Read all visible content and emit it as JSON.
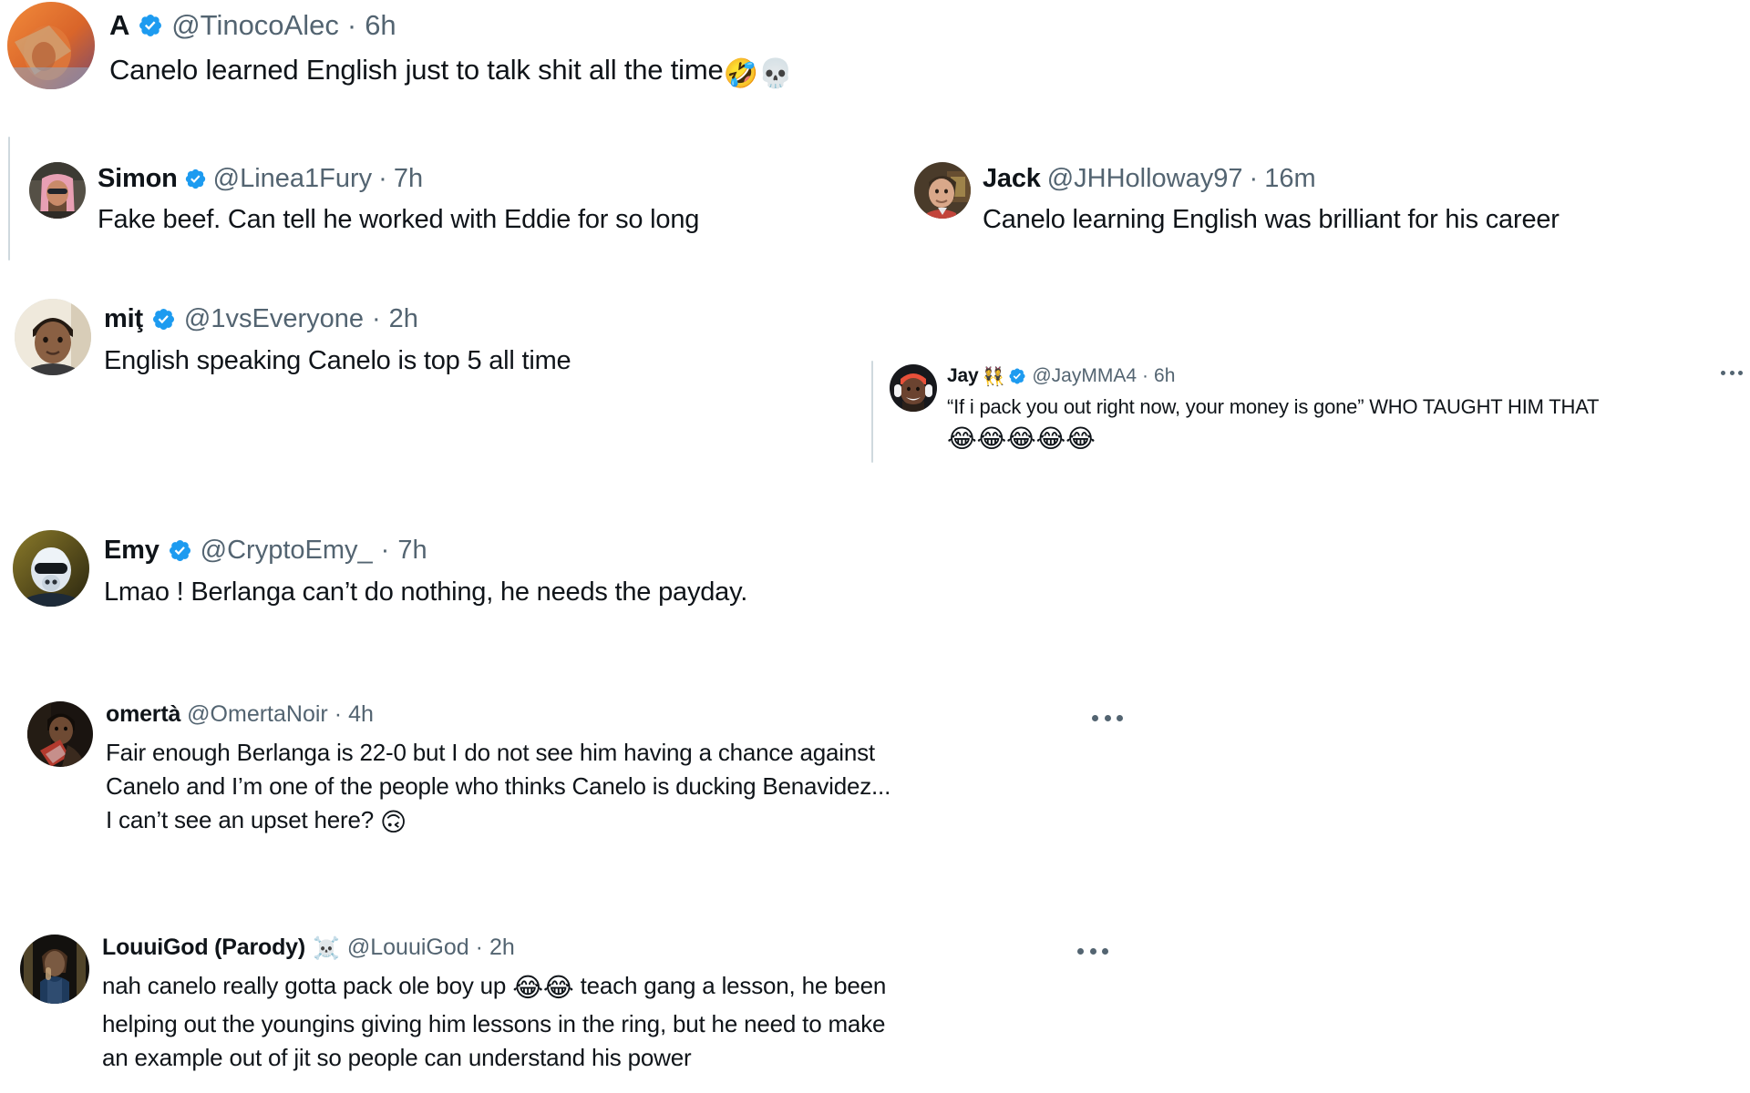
{
  "theme": {
    "background": "#ffffff",
    "text_primary": "#0f1419",
    "text_secondary": "#536471",
    "verified_blue": "#1d9bf0",
    "thread_line": "#cfd9de"
  },
  "tweets": [
    {
      "id": "tweet-tinocoalec",
      "display_name": "A",
      "verified": true,
      "handle": "@TinocoAlec",
      "separator": "·",
      "timestamp": "6h",
      "text": "Canelo learned English just to talk shit all the time",
      "trailing_emoji": "🤣💀",
      "has_more_menu": false
    },
    {
      "id": "tweet-linea1fury",
      "display_name": "Simon",
      "verified": true,
      "handle": "@Linea1Fury",
      "separator": "·",
      "timestamp": "7h",
      "text": "Fake beef. Can tell he worked with Eddie for so long",
      "has_more_menu": false
    },
    {
      "id": "tweet-jhholloway97",
      "display_name": "Jack",
      "verified": false,
      "handle": "@JHHolloway97",
      "separator": "·",
      "timestamp": "16m",
      "text": "Canelo learning English was brilliant for his career",
      "has_more_menu": false
    },
    {
      "id": "tweet-1vseveryone",
      "display_name": "miţ",
      "verified": true,
      "handle": "@1vsEveryone",
      "separator": "·",
      "timestamp": "2h",
      "text": "English speaking Canelo is top 5 all time",
      "has_more_menu": false
    },
    {
      "id": "tweet-jaymma4",
      "display_name": "Jay",
      "name_emoji": "👯",
      "verified": true,
      "handle": "@JayMMA4",
      "separator": "·",
      "timestamp": "6h",
      "text": "“If i pack you out right now, your money is gone” WHO TAUGHT HIM THAT",
      "trailing_emoji": "😂😂😂😂😂",
      "has_more_menu": true
    },
    {
      "id": "tweet-cryptoemy",
      "display_name": "Emy",
      "verified": true,
      "handle": "@CryptoEmy_",
      "separator": "·",
      "timestamp": "7h",
      "text": "Lmao ! Berlanga can’t do nothing, he needs the payday.",
      "has_more_menu": false
    },
    {
      "id": "tweet-omertanoir",
      "display_name": "omertà",
      "verified": false,
      "handle": "@OmertaNoir",
      "separator": "·",
      "timestamp": "4h",
      "line1": "Fair enough Berlanga is 22-0 but I do not see him having a chance against",
      "line2": "Canelo and I’m one of the people who thinks Canelo is ducking Benavidez...",
      "line3": "I can’t see an upset here? ",
      "line3_emoji": "🙃",
      "has_more_menu": true
    },
    {
      "id": "tweet-louuigod",
      "display_name": "LouuiGod (Parody)",
      "name_emoji": "☠️",
      "verified": false,
      "handle": "@LouuiGod",
      "separator": "·",
      "timestamp": "2h",
      "line1a": "nah canelo really gotta pack ole boy up ",
      "line1_emoji": "😂😂",
      "line1b": " teach gang a lesson, he been",
      "line2": "helping out the youngins giving him lessons in the ring, but he need to make",
      "line3": "an example out of jit so people can understand his power",
      "has_more_menu": true
    }
  ],
  "icons": {
    "verified": "verified-badge-icon",
    "more": "more-options-icon"
  }
}
